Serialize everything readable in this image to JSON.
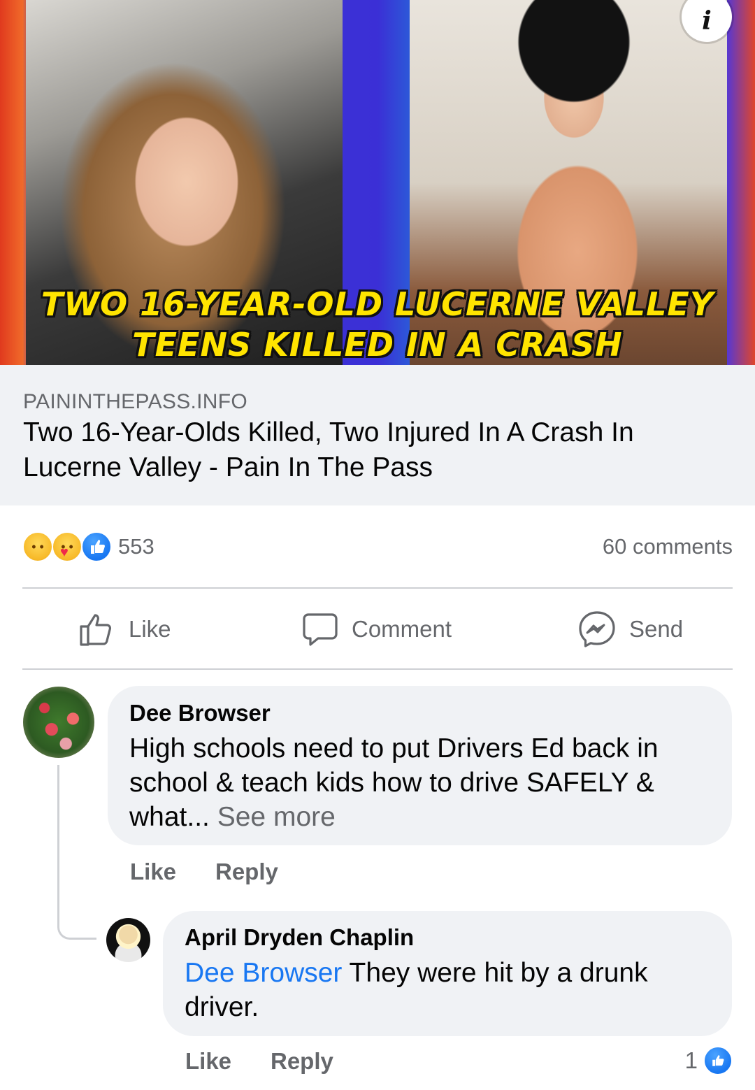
{
  "preview": {
    "headline_line1": "TWO 16-YEAR-OLD LUCERNE VALLEY",
    "headline_line2": "TEENS KILLED IN A CRASH",
    "info_glyph": "i",
    "domain": "PAININTHEPASS.INFO",
    "title": "Two 16-Year-Olds Killed, Two Injured In A Crash In Lucerne Valley - Pain In The Pass"
  },
  "stats": {
    "reaction_icons": [
      "sad-reaction-icon",
      "care-reaction-icon",
      "like-reaction-icon"
    ],
    "reaction_count": "553",
    "comments_count": "60 comments"
  },
  "actions": {
    "like": "Like",
    "comment": "Comment",
    "send": "Send"
  },
  "comments": [
    {
      "author": "Dee Browser",
      "text": "High schools need to put Drivers Ed back in school & teach kids how to drive SAFELY & what...",
      "see_more": " See more",
      "like": "Like",
      "reply": "Reply"
    },
    {
      "author": "April Dryden Chaplin",
      "mention": "Dee Browser",
      "text": " They were hit by a drunk driver.",
      "like": "Like",
      "reply": "Reply",
      "like_count": "1"
    }
  ],
  "colors": {
    "accent_blue": "#1877f2",
    "secondary_text": "#65676b",
    "bubble_bg": "#f0f2f5",
    "headline_yellow": "#ffe400"
  }
}
